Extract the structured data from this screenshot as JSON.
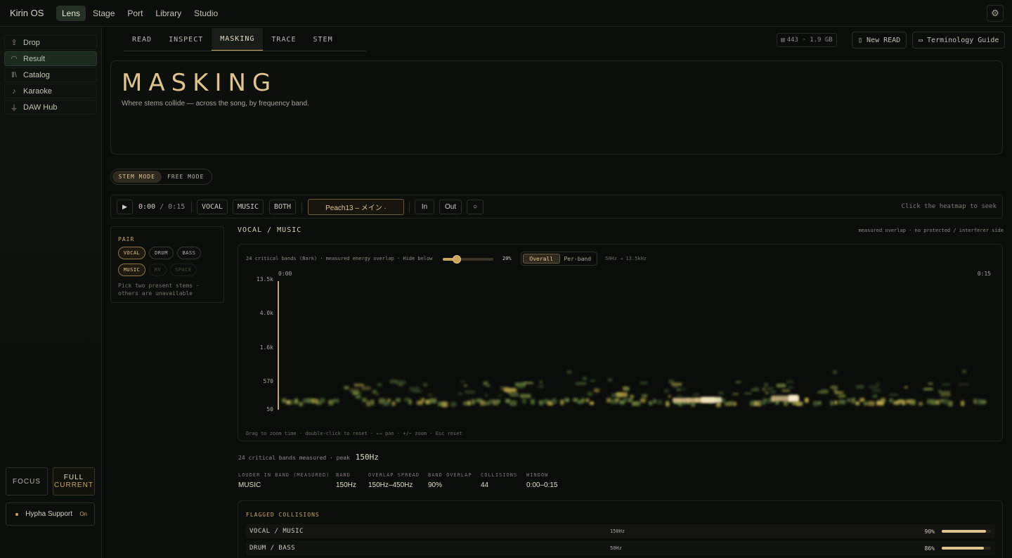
{
  "app": {
    "title": "Kirin OS"
  },
  "topnav": [
    {
      "label": "Lens",
      "active": true
    },
    {
      "label": "Stage",
      "active": false
    },
    {
      "label": "Port",
      "active": false
    },
    {
      "label": "Library",
      "active": false
    },
    {
      "label": "Studio",
      "active": false
    }
  ],
  "settings_icon": "gear-icon",
  "sidebar": {
    "items": [
      {
        "label": "Drop",
        "icon": "upload-icon",
        "active": false
      },
      {
        "label": "Result",
        "icon": "refresh-icon",
        "active": true
      },
      {
        "label": "Catalog",
        "icon": "library-icon",
        "active": false
      },
      {
        "label": "Karaoke",
        "icon": "microphone-icon",
        "active": false
      },
      {
        "label": "DAW Hub",
        "icon": "plug-icon",
        "active": false
      }
    ],
    "focus_label": "FOCUS",
    "full_label": "FULL",
    "full_sub": "CURRENT",
    "hypha_label": "Hypha Support",
    "hypha_state": "On"
  },
  "subtabs": [
    {
      "label": "READ",
      "active": false
    },
    {
      "label": "INSPECT",
      "active": false
    },
    {
      "label": "MASKING",
      "active": true
    },
    {
      "label": "TRACE",
      "active": false
    },
    {
      "label": "STEM",
      "active": false
    }
  ],
  "header_right": {
    "stat": "443 · 1.9 GB",
    "new_read": "New READ",
    "guide": "Terminology Guide"
  },
  "hero": {
    "title": "MASKING",
    "subtitle": "Where stems collide — across the song, by frequency band."
  },
  "mode": {
    "stem": "STEM MODE",
    "free": "FREE MODE",
    "active": "stem"
  },
  "controls": {
    "play_icon": "play-icon",
    "time_current": "0:00",
    "time_total": "/ 0:15",
    "vocal": "VOCAL",
    "music": "MUSIC",
    "both": "BOTH",
    "song": "Peach13 – メイン ·",
    "in": "In",
    "out": "Out",
    "reset": "○",
    "hint": "Click the heatmap to seek"
  },
  "pair": {
    "label": "PAIR",
    "chips": [
      {
        "label": "VOCAL",
        "state": "selected"
      },
      {
        "label": "DRUM",
        "state": "available"
      },
      {
        "label": "BASS",
        "state": "available"
      },
      {
        "label": "MUSIC",
        "state": "selected"
      },
      {
        "label": "RV",
        "state": "unavailable"
      },
      {
        "label": "SPACE",
        "state": "unavailable"
      }
    ],
    "note": "Pick two present stems · others are unavailable"
  },
  "heatmap": {
    "heading": "VOCAL / MUSIC",
    "meta": "measured overlap · no protected / interferer side",
    "desc": "24 critical bands (Bark) · measured energy overlap · Hide below",
    "threshold": 0.2,
    "threshold_label": "20%",
    "view_overall": "Overall",
    "view_perband": "Per-band",
    "freq_range": "50Hz → 13.5kHz",
    "t_start": "0:00",
    "t_end": "0:15",
    "y_ticks": [
      "13.5k",
      "4.0k",
      "1.6k",
      "570",
      "50"
    ],
    "footer": "Drag to zoom time · double-click to reset · ←→ pan · +/− zoom · Esc reset"
  },
  "chart_data": {
    "type": "heatmap",
    "x": "time (0:00–0:15)",
    "y_bands": [
      "50",
      "570",
      "1.6k",
      "4.0k",
      "13.5k"
    ],
    "peak_band": "150Hz"
  },
  "summary": {
    "peak_text": "24 critical bands measured · peak",
    "peak_value": "150Hz",
    "metrics": [
      {
        "label": "LOUDER IN BAND (MEASURED)",
        "value": "MUSIC"
      },
      {
        "label": "BAND",
        "value": "150Hz"
      },
      {
        "label": "OVERLAP SPREAD",
        "value": "150Hz–450Hz"
      },
      {
        "label": "BAND OVERLAP",
        "value": "90%"
      },
      {
        "label": "COLLISIONS",
        "value": "44"
      },
      {
        "label": "WINDOW",
        "value": "0:00–0:15"
      }
    ]
  },
  "flagged": {
    "title": "FLAGGED COLLISIONS",
    "rows": [
      {
        "pair": "VOCAL / MUSIC",
        "band": "150Hz",
        "value": "90%",
        "fraction": 0.9
      },
      {
        "pair": "DRUM / BASS",
        "band": "50Hz",
        "value": "86%",
        "fraction": 0.86
      }
    ]
  }
}
